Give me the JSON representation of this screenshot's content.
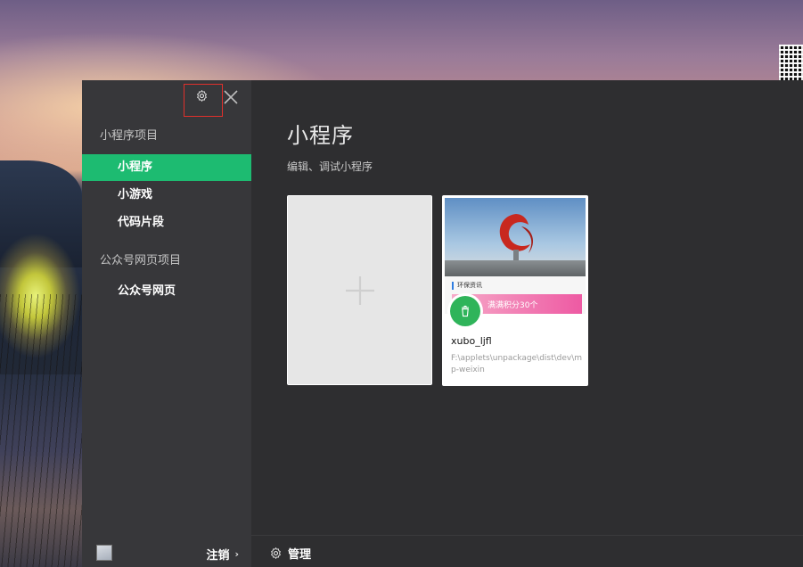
{
  "sidebar": {
    "sections": [
      {
        "label": "小程序项目"
      },
      {
        "label": "公众号网页项目"
      }
    ],
    "items": [
      {
        "label": "小程序",
        "active": true
      },
      {
        "label": "小游戏",
        "active": false
      },
      {
        "label": "代码片段",
        "active": false
      },
      {
        "label": "公众号网页",
        "active": false
      }
    ],
    "logout_label": "注销",
    "logout_chevron": "›"
  },
  "main": {
    "title": "小程序",
    "subtitle": "编辑、调试小程序",
    "new_project_icon": "plus-icon",
    "projects": [
      {
        "name": "xubo_ljfl",
        "path": "F:\\applets\\unpackage\\dist\\dev\\mp-weixin",
        "thumb_tab_text": "环保资讯",
        "thumb_banner_text": "满满积分30个",
        "badge_icon": "recycle-icon"
      }
    ],
    "manage_label": "管理"
  },
  "icons": {
    "settings": "gear-icon",
    "close": "close-icon",
    "manage": "gear-icon"
  },
  "colors": {
    "accent": "#1dbb71",
    "window_bg": "#2e2e30",
    "sidebar_bg": "#37373a",
    "highlight_box": "#e0302c"
  }
}
